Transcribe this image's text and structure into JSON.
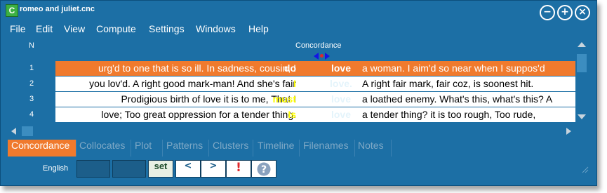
{
  "window": {
    "title": "romeo and juliet.cnc",
    "app_icon": "C",
    "controls": {
      "minimize": "−",
      "maximize": "+",
      "close": "×"
    }
  },
  "menu": [
    "File",
    "Edit",
    "View",
    "Compute",
    "Settings",
    "Windows",
    "Help"
  ],
  "columns": {
    "n": "N",
    "concordance": "Concordance"
  },
  "rows": [
    {
      "n": "1",
      "left": "urg'd to one that is so ill. In sadness, cousin, I",
      "context_word": "do",
      "node": "love",
      "right": "a woman. I aim'd so near when I suppos'd",
      "selected": true
    },
    {
      "n": "2",
      "left": "you lov'd. A right good mark-man! And she's fair",
      "context_word": "I",
      "node": "love.",
      "right": "A right fair mark, fair coz, is soonest hit.",
      "selected": false
    },
    {
      "n": "3",
      "left": "Prodigious birth of love it is to me, That I",
      "context_word": "must",
      "node": "love",
      "right": "a loathed enemy. What's this, what's this? A",
      "selected": false
    },
    {
      "n": "4",
      "left": "love; Too great oppression for a tender thing.",
      "context_word": "Is",
      "node": "love",
      "right": "a tender thing? it is too rough, Too rude,",
      "selected": false
    }
  ],
  "colors": {
    "selected_row": "#f07a2d",
    "node_word": "#e4f4fb",
    "context_word": "#ffff00",
    "window_bg": "#1c6fa5"
  },
  "tabs": [
    "Concordance",
    "Collocates",
    "Plot",
    "Patterns",
    "Clusters",
    "Timeline",
    "Filenames",
    "Notes"
  ],
  "active_tab": "Concordance",
  "bottom": {
    "language": "English",
    "set_label": "set",
    "prev_label": "<",
    "next_label": ">",
    "alert_label": "!",
    "help_label": "?"
  },
  "icons": {
    "minimize": "minimize-icon",
    "maximize": "maximize-icon",
    "close": "close-icon",
    "sort_arrows": "sort-arrows-icon",
    "alert": "exclamation-icon",
    "help": "question-icon"
  }
}
